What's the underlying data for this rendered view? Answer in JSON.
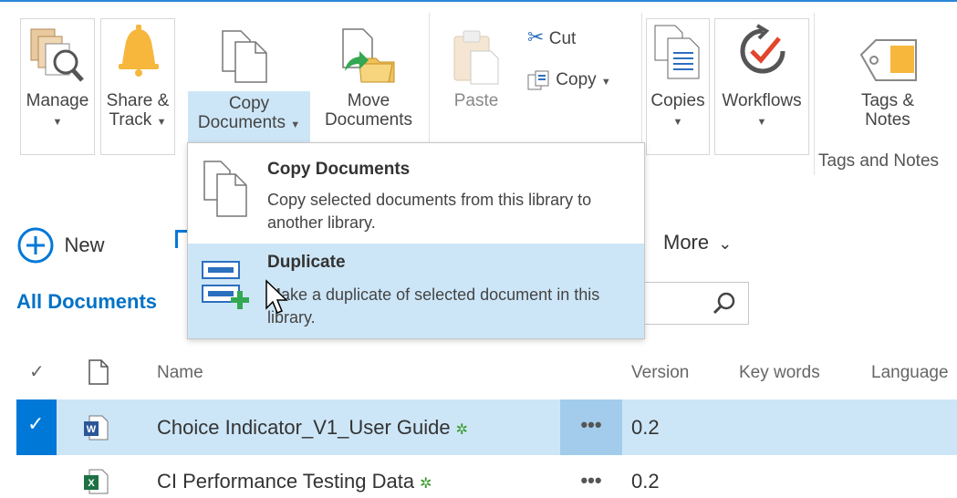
{
  "ribbon": {
    "manage": "Manage",
    "share_track_1": "Share &",
    "share_track_2": "Track",
    "copy_docs_1": "Copy",
    "copy_docs_2": "Documents",
    "move_docs_1": "Move",
    "move_docs_2": "Documents",
    "paste": "Paste",
    "cut": "Cut",
    "copy": "Copy",
    "copies": "Copies",
    "workflows": "Workflows",
    "tags_1": "Tags &",
    "tags_2": "Notes",
    "tags_group": "Tags and Notes"
  },
  "dropdown": {
    "items": [
      {
        "title": "Copy Documents",
        "desc": "Copy selected documents from this library to another library."
      },
      {
        "title": "Duplicate",
        "desc": "Make a duplicate of selected document in this library."
      }
    ]
  },
  "commandbar": {
    "new": "New",
    "more": "More"
  },
  "view": {
    "all_documents": "All Documents"
  },
  "table": {
    "headers": {
      "name": "Name",
      "version": "Version",
      "keywords": "Key words",
      "language": "Language"
    },
    "rows": [
      {
        "name": "Choice Indicator_V1_User Guide",
        "version": "0.2",
        "type": "word"
      },
      {
        "name": "CI Performance Testing Data",
        "version": "0.2",
        "type": "excel"
      }
    ],
    "ellipsis": "•••",
    "new_marker": "✲"
  },
  "colors": {
    "accent": "#0078d7",
    "selected": "#cde6f7",
    "link": "#0072c6"
  },
  "icons": [
    "manage-icon",
    "bell-icon",
    "copy-documents-icon",
    "move-documents-icon",
    "paste-icon",
    "scissors-icon",
    "copy-icon",
    "copies-icon",
    "workflows-icon",
    "tag-icon",
    "plus-circle-icon",
    "chevron-down-icon",
    "search-icon",
    "check-icon",
    "document-icon",
    "word-file-icon",
    "excel-file-icon",
    "duplicate-icon"
  ]
}
